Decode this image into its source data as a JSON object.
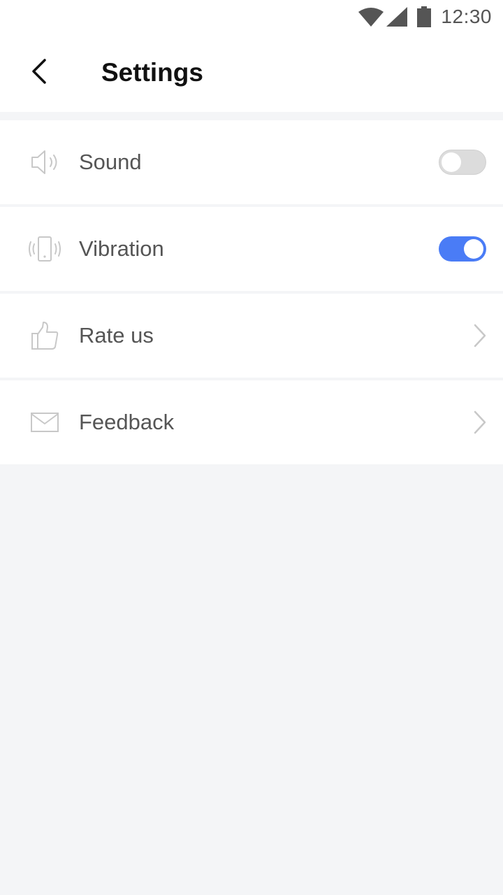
{
  "status_bar": {
    "time": "12:30",
    "icons": [
      "wifi-icon",
      "cellular-signal-icon",
      "battery-icon"
    ]
  },
  "header": {
    "title": "Settings",
    "back_icon": "chevron-left-icon"
  },
  "settings": [
    {
      "label": "Sound",
      "icon": "speaker-icon",
      "control": "toggle",
      "state": "off"
    },
    {
      "label": "Vibration",
      "icon": "vibrating-phone-icon",
      "control": "toggle",
      "state": "on"
    },
    {
      "label": "Rate us",
      "icon": "thumbs-up-icon",
      "control": "chevron"
    },
    {
      "label": "Feedback",
      "icon": "envelope-icon",
      "control": "chevron"
    }
  ],
  "colors": {
    "accent": "#4a7cf6",
    "background": "#f4f5f7",
    "row_background": "#ffffff",
    "label_text": "#555555",
    "icon_stroke": "#c8c8c8",
    "toggle_off": "#dcdcdc"
  }
}
